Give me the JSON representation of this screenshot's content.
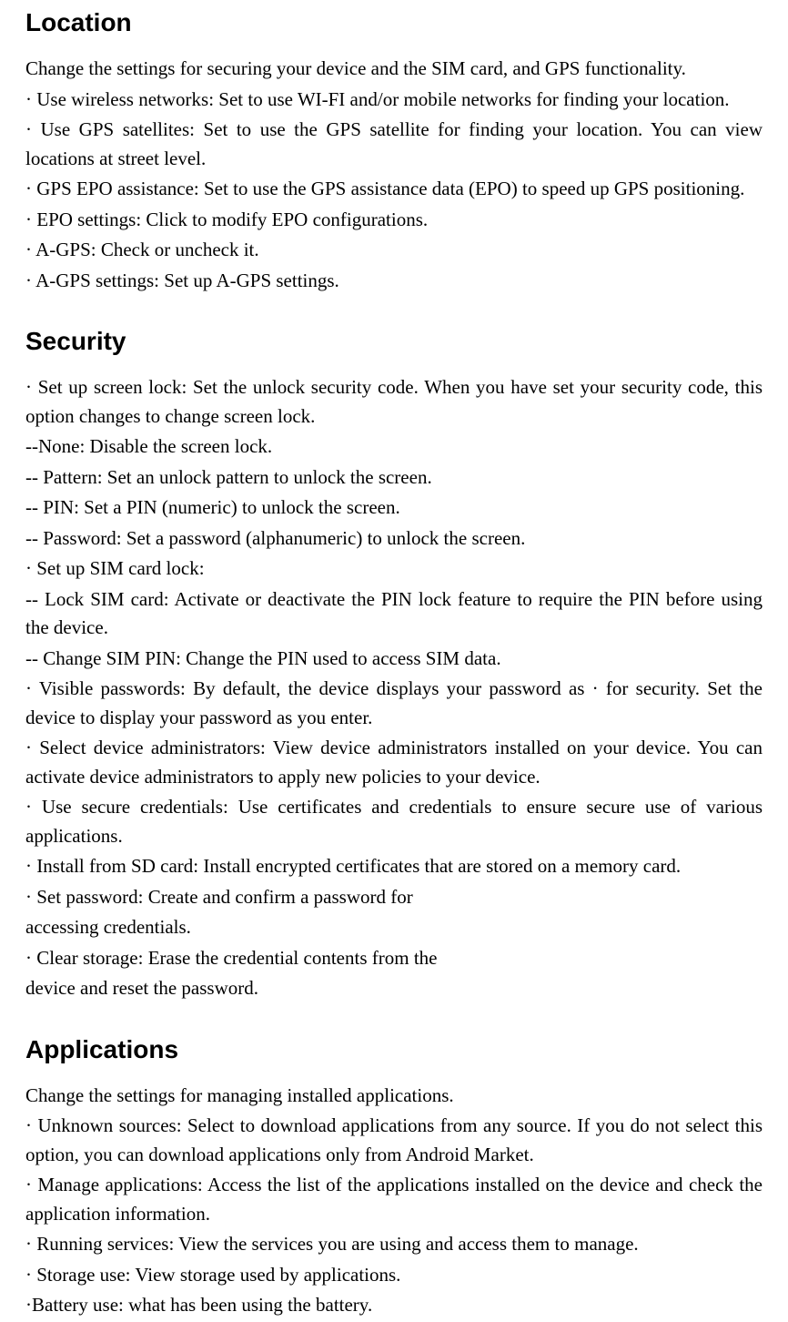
{
  "sections": {
    "location": {
      "title": "Location",
      "intro": "Change the settings for securing your device and the SIM card, and GPS functionality.",
      "items": [
        "· Use wireless networks: Set to use WI-FI and/or mobile networks for finding your location.",
        "· Use GPS satellites: Set to use the GPS satellite for finding your location. You can view locations at street level.",
        "· GPS EPO assistance: Set to use the GPS assistance data (EPO) to speed up GPS positioning.",
        "· EPO settings: Click to modify EPO configurations.",
        "· A-GPS: Check or uncheck it.",
        "· A-GPS settings: Set up A-GPS settings."
      ]
    },
    "security": {
      "title": "Security",
      "items": [
        "· Set up screen lock: Set the unlock security code. When you have set your security code, this option changes to change screen lock.",
        "--None: Disable the screen lock.",
        "-- Pattern: Set an unlock pattern to unlock the screen.",
        "-- PIN: Set a PIN (numeric) to unlock the screen.",
        "-- Password: Set a password (alphanumeric) to unlock the screen.",
        "· Set up SIM card lock:",
        "-- Lock SIM card: Activate or deactivate the PIN lock feature to require the PIN before using the device.",
        "-- Change SIM PIN: Change the PIN used to access SIM data.",
        "· Visible passwords: By default, the device displays your password as · for security. Set the device to display your password as you enter.",
        "· Select device administrators: View device administrators installed on your device. You can activate device administrators to apply new policies to your device.",
        "· Use secure credentials: Use certificates and credentials to ensure secure use of various applications.",
        "· Install from SD card: Install encrypted certificates that are stored on a memory card.",
        "· Set password: Create and confirm a password for",
        "accessing credentials.",
        "· Clear storage: Erase the credential contents from the",
        "device and reset the password."
      ]
    },
    "applications": {
      "title": "Applications",
      "intro": "Change the settings for managing installed applications.",
      "items": [
        "· Unknown sources: Select to download applications from any source. If you do not select this option, you can download applications only from Android Market.",
        "· Manage applications: Access the list of the applications installed on the device and check the application information.",
        "· Running services: View the services you are using and access them to manage.",
        "· Storage use: View storage used by applications.",
        "·Battery use: what has been using the battery."
      ]
    }
  }
}
